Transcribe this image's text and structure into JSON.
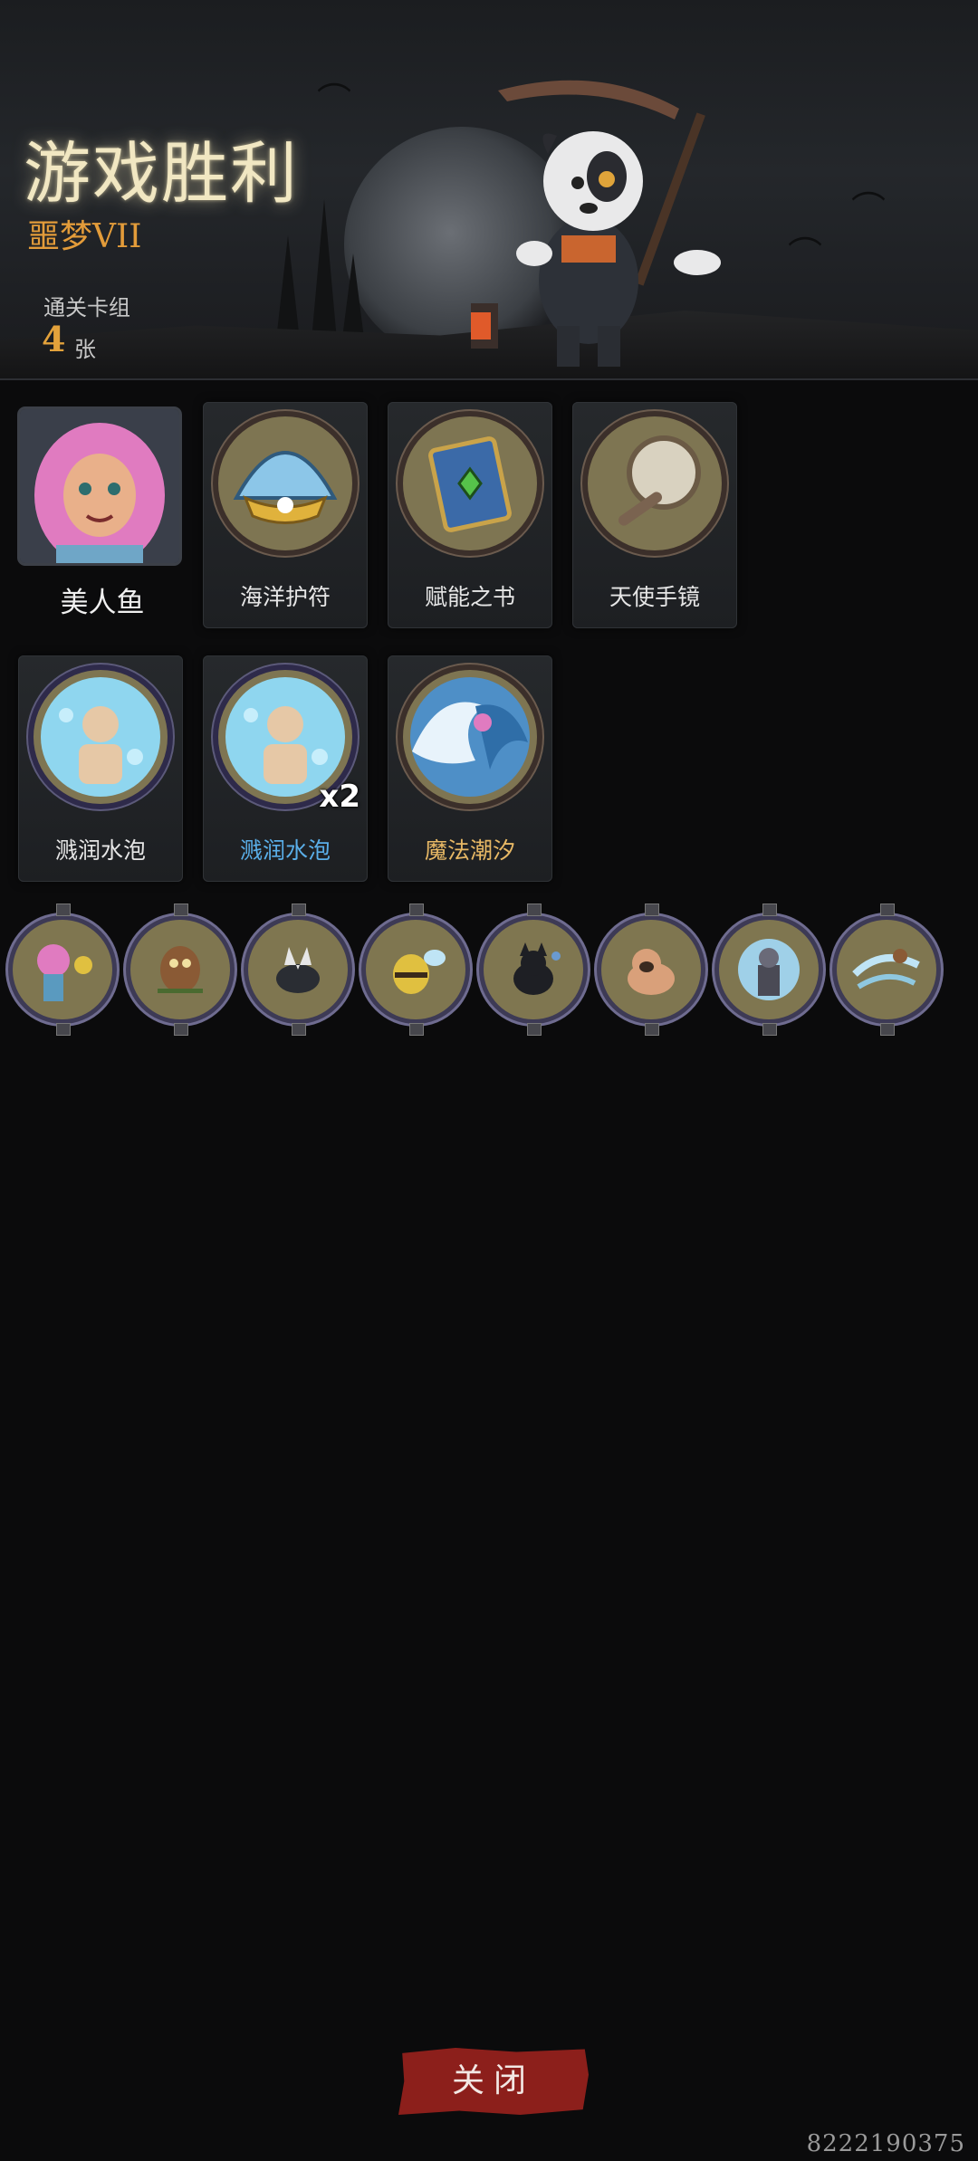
{
  "header": {
    "title": "游戏胜利",
    "difficulty": "噩梦VII",
    "deck_label": "通关卡组",
    "deck_count": "4",
    "deck_unit": "张"
  },
  "character": {
    "name": "美人鱼",
    "icon": "mermaid-portrait"
  },
  "cards_row1": [
    {
      "name": "海洋护符",
      "icon": "seashell-icon"
    },
    {
      "name": "赋能之书",
      "icon": "spellbook-icon"
    },
    {
      "name": "天使手镜",
      "icon": "hand-mirror-icon"
    }
  ],
  "cards_row2": [
    {
      "name": "溅润水泡",
      "icon": "water-bubble-icon",
      "badge": ""
    },
    {
      "name": "溅润水泡",
      "icon": "water-bubble-icon",
      "badge": "x2"
    },
    {
      "name": "魔法潮汐",
      "icon": "magic-tide-icon"
    }
  ],
  "companions": [
    "mermaid-companion-icon",
    "owl-companion-icon",
    "wolf-companion-icon",
    "bee-companion-icon",
    "cat-companion-icon",
    "pug-companion-icon",
    "viking-companion-icon",
    "wind-companion-icon"
  ],
  "footer": {
    "close_label": "关闭",
    "watermark": "8222190375"
  },
  "colors": {
    "title_glow": "#f1e7c2",
    "difficulty": "#e39c3a",
    "close_button": "#8c1f1b",
    "highlight_blue": "#5aaee8",
    "highlight_gold": "#e7b865"
  }
}
